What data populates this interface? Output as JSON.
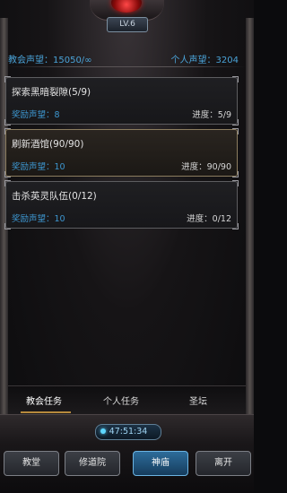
{
  "header": {
    "level": "LV.6",
    "church_reputation": "教会声望：15050/∞",
    "personal_reputation": "个人声望：3204"
  },
  "tasks": [
    {
      "title": "探索黑暗裂隙(5/9)",
      "reward": "奖励声望：8",
      "progress": "进度：5/9",
      "active": false
    },
    {
      "title": "刷新酒馆(90/90)",
      "reward": "奖励声望：10",
      "progress": "进度：90/90",
      "active": true
    },
    {
      "title": "击杀英灵队伍(0/12)",
      "reward": "奖励声望：10",
      "progress": "进度：0/12",
      "active": false
    }
  ],
  "tabs": [
    {
      "label": "教会任务",
      "selected": true
    },
    {
      "label": "个人任务",
      "selected": false
    },
    {
      "label": "圣坛",
      "selected": false
    }
  ],
  "timer": "47:51:34",
  "bottom_nav": [
    {
      "label": "教堂",
      "selected": false
    },
    {
      "label": "修道院",
      "selected": false
    },
    {
      "label": "神庙",
      "selected": true
    },
    {
      "label": "离开",
      "selected": false
    }
  ],
  "colors": {
    "reputation_text": "#4aa3d8",
    "active_tab_underline": "#b68a3c",
    "active_nav": "#2d6c9a"
  }
}
